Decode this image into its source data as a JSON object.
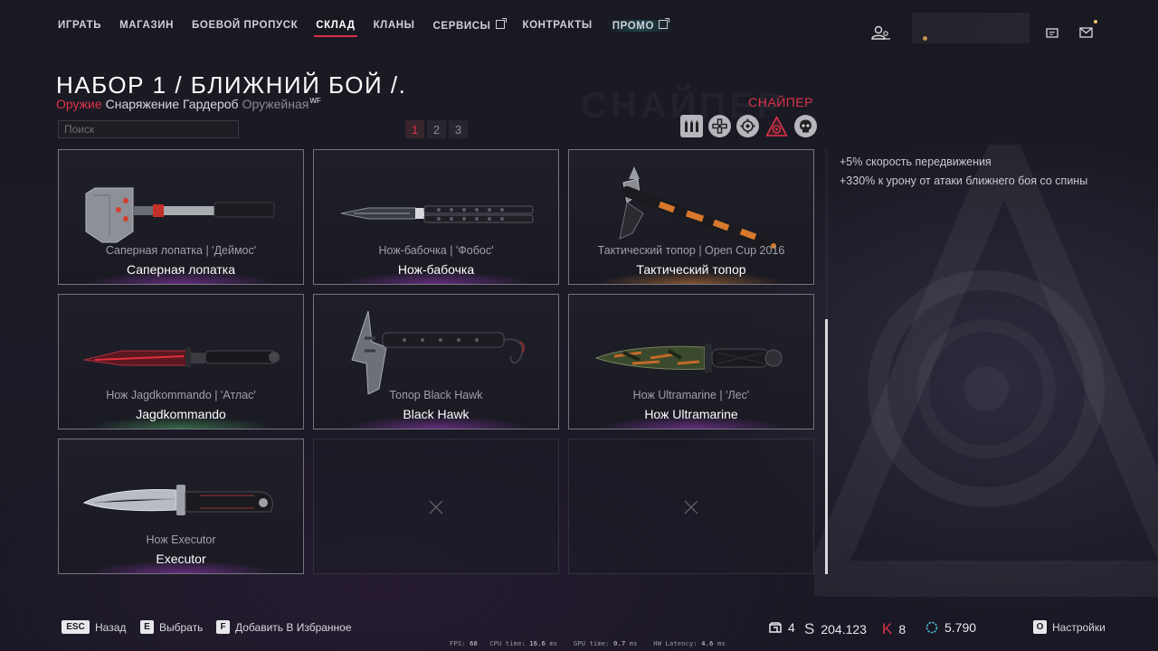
{
  "nav": {
    "items": [
      {
        "label": "ИГРАТЬ"
      },
      {
        "label": "МАГАЗИН"
      },
      {
        "label": "БОЕВОЙ ПРОПУСК"
      },
      {
        "label": "СКЛАД"
      },
      {
        "label": "КЛАНЫ"
      },
      {
        "label": "СЕРВИСЫ"
      },
      {
        "label": "КОНТРАКТЫ"
      },
      {
        "label": "ПРОМО"
      }
    ],
    "active": "СКЛАД"
  },
  "header": {
    "title": "НАБОР 1 / БЛИЖНИЙ БОЙ /."
  },
  "tabs": [
    {
      "label": "Оружие"
    },
    {
      "label": "Снаряжение"
    },
    {
      "label": "Гардероб"
    },
    {
      "label": "Оружейная",
      "badge": "WF"
    }
  ],
  "class": {
    "label": "СНАЙПЕР",
    "accent": "#e0324a"
  },
  "search": {
    "placeholder": "Поиск"
  },
  "pagination": {
    "pages": [
      "1",
      "2",
      "3"
    ],
    "current": "1"
  },
  "class_filters": [
    "ammo-icon",
    "medic-icon",
    "engineer-icon",
    "sniper-icon",
    "sed-icon"
  ],
  "items": [
    {
      "skin": "Саперная лопатка | 'Деймос'",
      "name": "Саперная лопатка",
      "rarity": "purple"
    },
    {
      "skin": "Нож-бабочка | 'Фобос'",
      "name": "Нож-бабочка",
      "rarity": "purple"
    },
    {
      "skin": "Тактический топор | Open Cup 2016",
      "name": "Тактический топор",
      "rarity": "orange"
    },
    {
      "skin": "Нож Jagdkommando | 'Атлас'",
      "name": "Jagdkommando",
      "rarity": "green"
    },
    {
      "skin": "Топор Black Hawk",
      "name": "Black Hawk",
      "rarity": "purple"
    },
    {
      "skin": "Нож Ultramarine | 'Лес'",
      "name": "Нож Ultramarine",
      "rarity": "purple"
    },
    {
      "skin": "Нож Executor",
      "name": "Executor",
      "rarity": "purple"
    }
  ],
  "bonuses": [
    "+5%  скорость передвижения",
    "+330%  к урону от атаки ближнего боя со спины"
  ],
  "hints": [
    {
      "key": "ESC",
      "label": "Назад"
    },
    {
      "key": "E",
      "label": "Выбрать"
    },
    {
      "key": "F",
      "label": "Добавить В Избранное"
    }
  ],
  "currencies": {
    "boxes": "4",
    "warbucks": "204.123",
    "kredits": "8",
    "crowns": "5.790"
  },
  "settings": {
    "key": "O",
    "label": "Настройки"
  },
  "perf": {
    "fps_label": "FPS:",
    "fps": "60",
    "cpu_label": "CPU time:",
    "cpu": "16.6",
    "cpu_unit": "ms",
    "gpu_label": "GPU time:",
    "gpu": "0.7",
    "gpu_unit": "ms",
    "lat_label": "HW Latency:",
    "lat": "4.6",
    "lat_unit": "ms"
  }
}
